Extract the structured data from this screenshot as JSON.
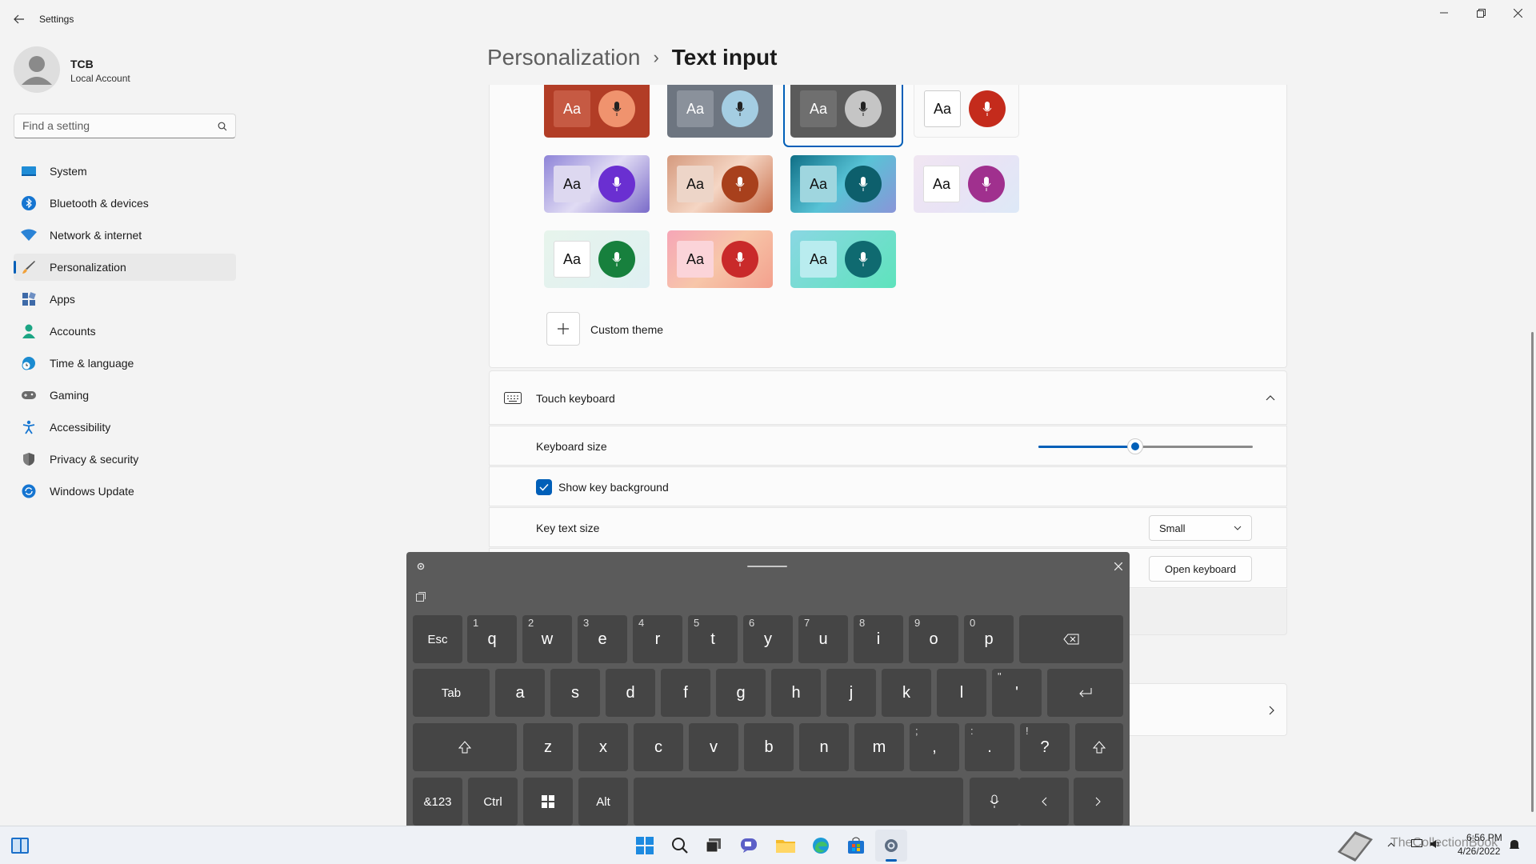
{
  "window": {
    "title": "Settings"
  },
  "user": {
    "name": "TCB",
    "account_type": "Local Account"
  },
  "search": {
    "placeholder": "Find a setting"
  },
  "sidebar": {
    "items": [
      {
        "label": "System",
        "icon": "monitor-icon"
      },
      {
        "label": "Bluetooth & devices",
        "icon": "bluetooth-icon"
      },
      {
        "label": "Network & internet",
        "icon": "wifi-icon"
      },
      {
        "label": "Personalization",
        "icon": "brush-icon",
        "selected": true
      },
      {
        "label": "Apps",
        "icon": "apps-icon"
      },
      {
        "label": "Accounts",
        "icon": "person-icon"
      },
      {
        "label": "Time & language",
        "icon": "globe-clock-icon"
      },
      {
        "label": "Gaming",
        "icon": "gamepad-icon"
      },
      {
        "label": "Accessibility",
        "icon": "accessibility-icon"
      },
      {
        "label": "Privacy & security",
        "icon": "shield-icon"
      },
      {
        "label": "Windows Update",
        "icon": "update-icon"
      }
    ]
  },
  "breadcrumb": {
    "parent": "Personalization",
    "separator": "›",
    "current": "Text input"
  },
  "themes": {
    "tile_text": "Aa",
    "custom_theme_label": "Custom theme",
    "colors": {
      "accent": "#0067c0",
      "selected_border": "#005fb8"
    }
  },
  "touch_keyboard": {
    "section_title": "Touch keyboard",
    "keyboard_size_label": "Keyboard size",
    "keyboard_size_value": 0.45,
    "show_key_background_label": "Show key background",
    "show_key_background_checked": true,
    "key_text_size_label": "Key text size",
    "key_text_size_value": "Small",
    "open_keyboard_label": "Open keyboard"
  },
  "keyboard": {
    "row1": [
      {
        "k": "Esc"
      },
      {
        "k": "q",
        "s": "1"
      },
      {
        "k": "w",
        "s": "2"
      },
      {
        "k": "e",
        "s": "3"
      },
      {
        "k": "r",
        "s": "4"
      },
      {
        "k": "t",
        "s": "5"
      },
      {
        "k": "y",
        "s": "6"
      },
      {
        "k": "u",
        "s": "7"
      },
      {
        "k": "i",
        "s": "8"
      },
      {
        "k": "o",
        "s": "9"
      },
      {
        "k": "p",
        "s": "0"
      }
    ],
    "row2": [
      {
        "k": "Tab"
      },
      {
        "k": "a"
      },
      {
        "k": "s"
      },
      {
        "k": "d"
      },
      {
        "k": "f"
      },
      {
        "k": "g"
      },
      {
        "k": "h"
      },
      {
        "k": "j"
      },
      {
        "k": "k"
      },
      {
        "k": "l"
      },
      {
        "k": "'",
        "s": "\""
      }
    ],
    "row3": [
      {
        "k": "z"
      },
      {
        "k": "x"
      },
      {
        "k": "c"
      },
      {
        "k": "v"
      },
      {
        "k": "b"
      },
      {
        "k": "n"
      },
      {
        "k": "m"
      },
      {
        "k": ",",
        "s": ";"
      },
      {
        "k": ".",
        "s": ":"
      },
      {
        "k": "?",
        "s": "!"
      }
    ],
    "row4": [
      {
        "k": "&123"
      },
      {
        "k": "Ctrl"
      },
      {
        "k": "Alt"
      }
    ]
  },
  "tray": {
    "time": "6:56 PM",
    "date": "4/26/2022",
    "watermark": "TheCollectionBook"
  }
}
